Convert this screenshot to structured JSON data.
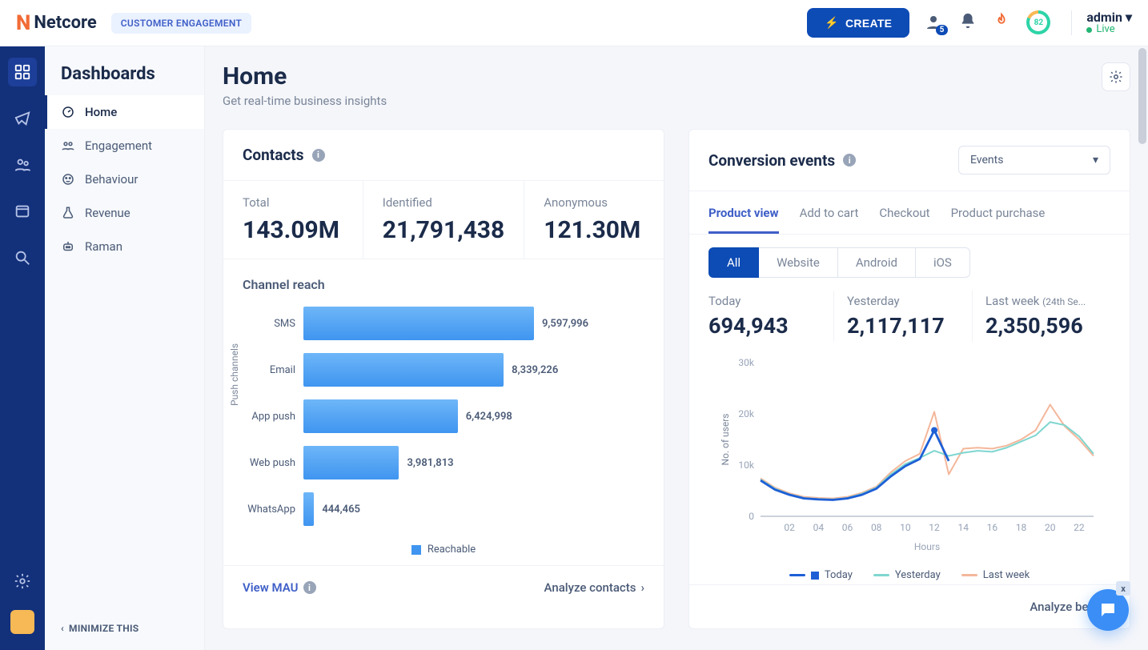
{
  "header": {
    "brand": "Netcore",
    "tagline": "CUSTOMER ENGAGEMENT",
    "create_label": "CREATE",
    "notif_count": "5",
    "ring_value": "82",
    "user_name": "admin",
    "user_status": "Live"
  },
  "rail": {
    "items": [
      "dashboard",
      "campaigns",
      "audience",
      "content",
      "analytics"
    ]
  },
  "sidebar": {
    "title": "Dashboards",
    "items": [
      {
        "label": "Home"
      },
      {
        "label": "Engagement"
      },
      {
        "label": "Behaviour"
      },
      {
        "label": "Revenue"
      },
      {
        "label": "Raman"
      }
    ],
    "minimize_label": "MINIMIZE THIS"
  },
  "page": {
    "title": "Home",
    "subtitle": "Get real-time business insights"
  },
  "contacts": {
    "title": "Contacts",
    "stats": [
      {
        "label": "Total",
        "value": "143.09M"
      },
      {
        "label": "Identified",
        "value": "21,791,438"
      },
      {
        "label": "Anonymous",
        "value": "121.30M"
      }
    ],
    "channel_reach_title": "Channel reach",
    "push_axis_label": "Push channels",
    "legend": "Reachable",
    "view_mau_label": "View MAU",
    "analyze_label": "Analyze contacts"
  },
  "conversion": {
    "title": "Conversion events",
    "dropdown": "Events",
    "tabs": [
      "Product view",
      "Add to cart",
      "Checkout",
      "Product purchase"
    ],
    "segments": [
      "All",
      "Website",
      "Android",
      "iOS"
    ],
    "stats": [
      {
        "label": "Today",
        "value": "694,943"
      },
      {
        "label": "Yesterday",
        "value": "2,117,117"
      },
      {
        "label": "Last week",
        "sub": "(24th Se...",
        "value": "2,350,596"
      }
    ],
    "y_ticks": [
      "30k",
      "20k",
      "10k",
      "0"
    ],
    "x_ticks": [
      "02",
      "04",
      "06",
      "08",
      "10",
      "12",
      "14",
      "16",
      "18",
      "20",
      "22"
    ],
    "x_label": "Hours",
    "y_label": "No. of users",
    "legend": [
      "Today",
      "Yesterday",
      "Last week"
    ],
    "analyze_label": "Analyze behavi"
  },
  "chart_data": [
    {
      "type": "bar",
      "orientation": "horizontal",
      "title": "Channel reach",
      "xlabel": "",
      "ylabel": "Push channels",
      "categories": [
        "SMS",
        "Email",
        "App push",
        "Web push",
        "WhatsApp"
      ],
      "series": [
        {
          "name": "Reachable",
          "values": [
            9597996,
            8339226,
            6424998,
            3981813,
            444465
          ]
        }
      ],
      "xlim": [
        0,
        10000000
      ]
    },
    {
      "type": "line",
      "title": "Conversion events — Product view",
      "xlabel": "Hours",
      "ylabel": "No. of users",
      "ylim": [
        0,
        30000
      ],
      "x": [
        0,
        1,
        2,
        3,
        4,
        5,
        6,
        7,
        8,
        9,
        10,
        11,
        12,
        13,
        14,
        15,
        16,
        17,
        18,
        19,
        20,
        21,
        22,
        23
      ],
      "series": [
        {
          "name": "Today",
          "values": [
            7000,
            5200,
            4200,
            3500,
            3300,
            3200,
            3500,
            4200,
            5400,
            7800,
            9800,
            11200,
            16800,
            10800,
            null,
            null,
            null,
            null,
            null,
            null,
            null,
            null,
            null,
            null
          ]
        },
        {
          "name": "Yesterday",
          "values": [
            7200,
            5400,
            4300,
            3600,
            3400,
            3300,
            3600,
            4400,
            5600,
            8200,
            10200,
            11400,
            12800,
            11800,
            12400,
            12800,
            12600,
            13400,
            14600,
            15800,
            18400,
            17800,
            15600,
            12200
          ]
        },
        {
          "name": "Last week",
          "values": [
            7400,
            5600,
            4500,
            3800,
            3600,
            3500,
            3800,
            4600,
            5800,
            8600,
            10800,
            12200,
            20400,
            8200,
            13200,
            13400,
            13200,
            13800,
            15000,
            16800,
            21800,
            17600,
            15000,
            11800
          ]
        }
      ]
    }
  ]
}
